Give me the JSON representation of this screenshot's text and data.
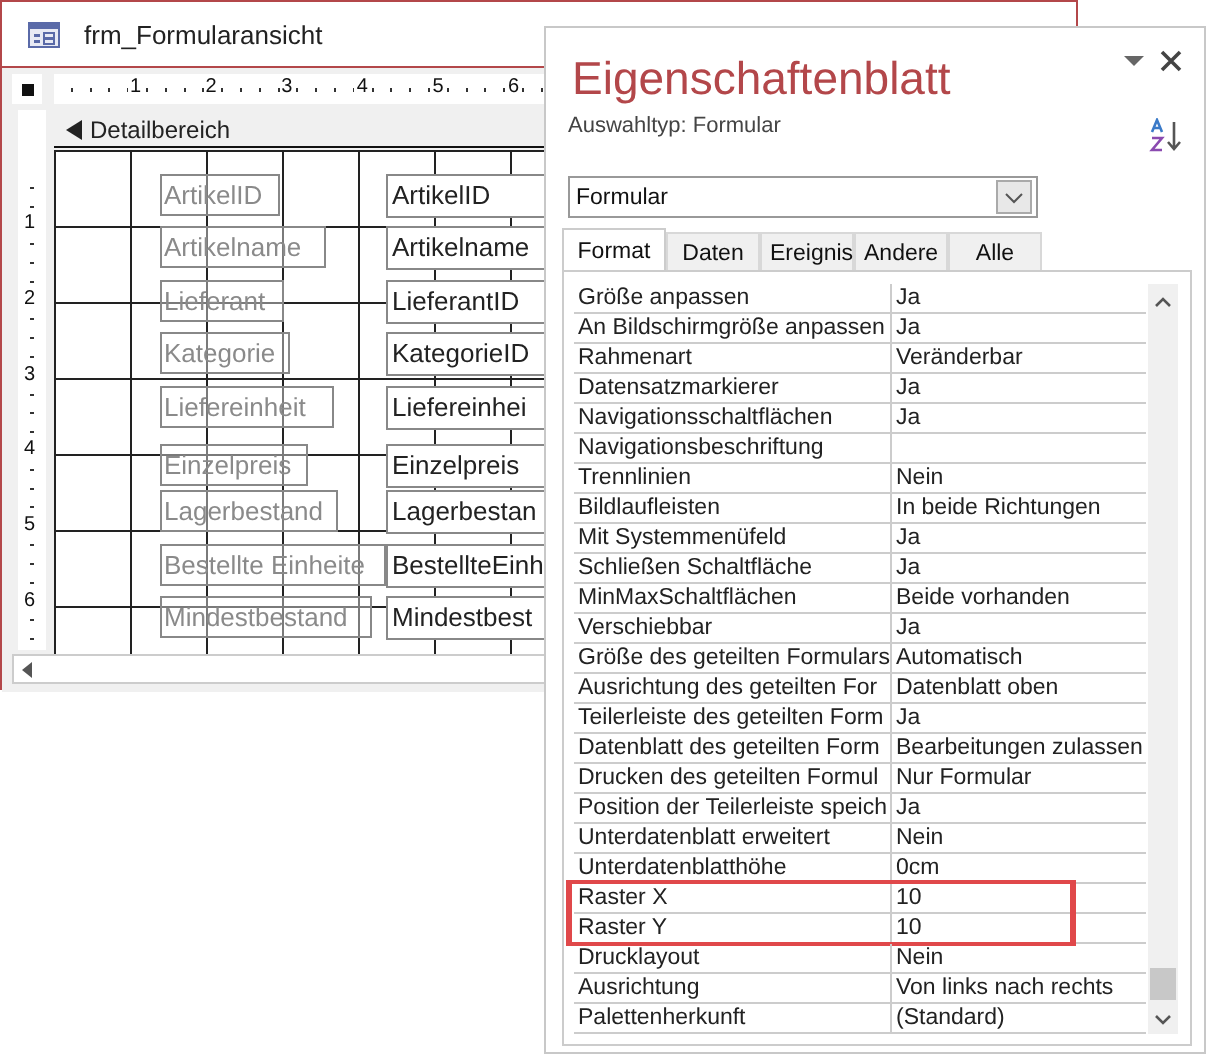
{
  "form_window": {
    "title": "frm_Formularansicht",
    "ruler_h": [
      "1",
      "2",
      "3",
      "4",
      "5",
      "6"
    ],
    "ruler_v": [
      "1",
      "2",
      "3",
      "4",
      "5",
      "6"
    ],
    "section": "Detailbereich",
    "controls": [
      {
        "label": "ArtikelID",
        "field": "ArtikelID"
      },
      {
        "label": "Artikelname",
        "field": "Artikelname"
      },
      {
        "label": "Lieferant",
        "field": "LieferantID"
      },
      {
        "label": "Kategorie",
        "field": "KategorieID"
      },
      {
        "label": "Liefereinheit",
        "field": "Liefereinhei"
      },
      {
        "label": "Einzelpreis",
        "field": "Einzelpreis"
      },
      {
        "label": "Lagerbestand",
        "field": "Lagerbestan"
      },
      {
        "label": "Bestellte Einheite",
        "field": "BestellteEinh"
      },
      {
        "label": "Mindestbestand",
        "field": "Mindestbest"
      }
    ]
  },
  "property_sheet": {
    "title": "Eigenschaftenblatt",
    "selection_type": "Auswahltyp:  Formular",
    "object": "Formular",
    "tabs": [
      {
        "label": "Format",
        "selected": true
      },
      {
        "label": "Daten",
        "selected": false
      },
      {
        "label": "Ereignis",
        "selected": false
      },
      {
        "label": "Andere",
        "selected": false
      },
      {
        "label": "Alle",
        "selected": false
      }
    ],
    "rows": [
      {
        "name": "Größe anpassen",
        "value": "Ja",
        "highlighted": false
      },
      {
        "name": "An Bildschirmgröße anpassen",
        "value": "Ja",
        "highlighted": false
      },
      {
        "name": "Rahmenart",
        "value": "Veränderbar",
        "highlighted": false
      },
      {
        "name": "Datensatzmarkierer",
        "value": "Ja",
        "highlighted": false
      },
      {
        "name": "Navigationsschaltflächen",
        "value": "Ja",
        "highlighted": false
      },
      {
        "name": "Navigationsbeschriftung",
        "value": "",
        "highlighted": false
      },
      {
        "name": "Trennlinien",
        "value": "Nein",
        "highlighted": false
      },
      {
        "name": "Bildlaufleisten",
        "value": "In beide Richtungen",
        "highlighted": false
      },
      {
        "name": "Mit Systemmenüfeld",
        "value": "Ja",
        "highlighted": false
      },
      {
        "name": "Schließen Schaltfläche",
        "value": "Ja",
        "highlighted": false
      },
      {
        "name": "MinMaxSchaltflächen",
        "value": "Beide vorhanden",
        "highlighted": false
      },
      {
        "name": "Verschiebbar",
        "value": "Ja",
        "highlighted": false
      },
      {
        "name": "Größe des geteilten Formulars",
        "value": "Automatisch",
        "highlighted": false
      },
      {
        "name": "Ausrichtung des geteilten For",
        "value": "Datenblatt oben",
        "highlighted": false
      },
      {
        "name": "Teilerleiste des geteilten Form",
        "value": "Ja",
        "highlighted": false
      },
      {
        "name": "Datenblatt des geteilten Form",
        "value": "Bearbeitungen zulassen",
        "highlighted": false
      },
      {
        "name": "Drucken des geteilten Formul",
        "value": "Nur Formular",
        "highlighted": false
      },
      {
        "name": "Position der Teilerleiste speich",
        "value": "Ja",
        "highlighted": false
      },
      {
        "name": "Unterdatenblatt erweitert",
        "value": "Nein",
        "highlighted": false
      },
      {
        "name": "Unterdatenblatthöhe",
        "value": "0cm",
        "highlighted": false
      },
      {
        "name": "Raster X",
        "value": "10",
        "highlighted": true
      },
      {
        "name": "Raster Y",
        "value": "10",
        "highlighted": true
      },
      {
        "name": "Drucklayout",
        "value": "Nein",
        "highlighted": false
      },
      {
        "name": "Ausrichtung",
        "value": "Von links nach rechts",
        "highlighted": false
      },
      {
        "name": "Palettenherkunft",
        "value": "(Standard)",
        "highlighted": false
      }
    ]
  }
}
